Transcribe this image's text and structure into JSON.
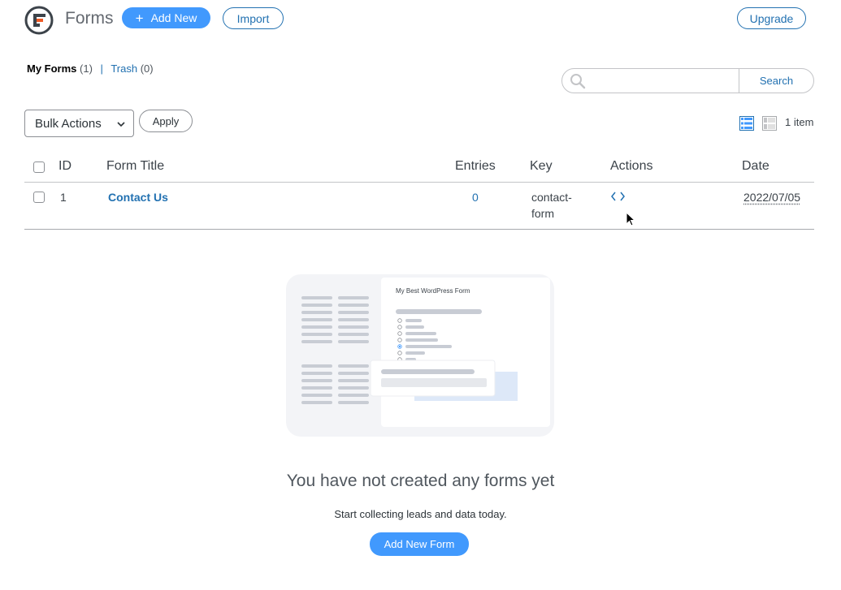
{
  "header": {
    "title": "Forms",
    "add_new_label": "Add New",
    "add_new_icon": "plus-icon",
    "import_label": "Import",
    "upgrade_label": "Upgrade",
    "logo_icon": "formidable-logo-icon",
    "accent_color": "#4199fd"
  },
  "views": {
    "my_forms_label": "My Forms",
    "my_forms_count": "(1)",
    "separator": "|",
    "trash_label": "Trash",
    "trash_count": "(0)"
  },
  "search": {
    "placeholder": "",
    "button_label": "Search",
    "icon": "search-icon"
  },
  "tablenav": {
    "bulk_actions_selected": "Bulk Actions",
    "apply_label": "Apply",
    "item_count": "1 item",
    "view_icons": [
      "list-view-icon",
      "excerpt-view-icon"
    ]
  },
  "table": {
    "columns": [
      "ID",
      "Form Title",
      "Entries",
      "Key",
      "Actions",
      "Date"
    ],
    "rows": [
      {
        "id": "1",
        "title": "Contact Us",
        "entries": "0",
        "key_line1": "contact-",
        "key_line2": "form",
        "action_icon": "code-embed-icon",
        "date": "2022/07/05"
      }
    ]
  },
  "empty_state": {
    "illustration_title": "My Best WordPress Form",
    "heading": "You have not created any forms yet",
    "subtext": "Start collecting leads and data today.",
    "button_label": "Add New Form"
  }
}
